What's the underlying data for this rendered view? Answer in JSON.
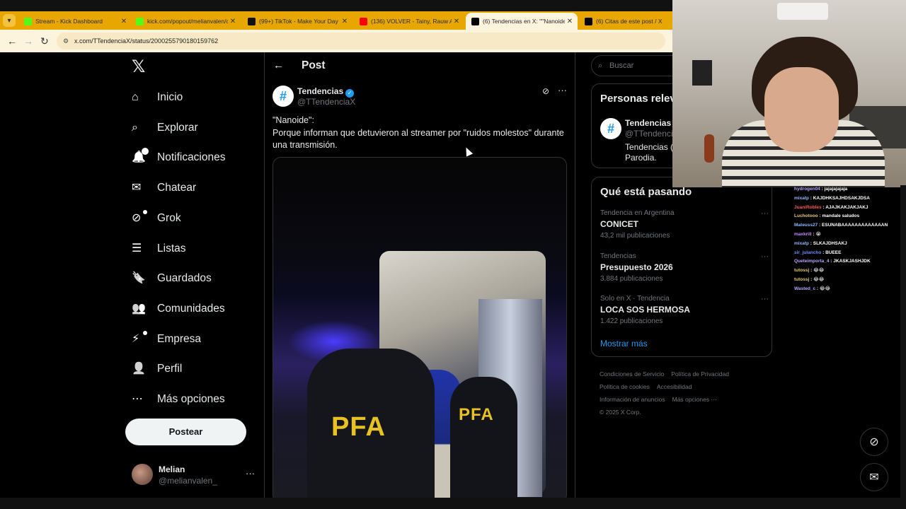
{
  "browser": {
    "tabs": [
      {
        "title": "Stream - Kick Dashboard",
        "favicon": "kick-icon",
        "color": "#53fc18"
      },
      {
        "title": "kick.com/popout/melianvalen/c",
        "favicon": "kick-icon",
        "color": "#53fc18"
      },
      {
        "title": "(99+) TikTok - Make Your Day",
        "favicon": "tiktok-icon",
        "color": "#111111"
      },
      {
        "title": "(136) VOLVER - Tainy, Rauw Ale",
        "favicon": "youtube-icon",
        "color": "#ff0000"
      },
      {
        "title": "(6) Tendencias en X: \"\"Nanoide\"",
        "favicon": "x-icon",
        "color": "#000000"
      },
      {
        "title": "(6) Citas de este post / X",
        "favicon": "x-icon",
        "color": "#000000"
      }
    ],
    "url": "x.com/TTendenciaX/status/2000255790180159762"
  },
  "nav": {
    "items": [
      {
        "label": "Inicio",
        "icon": "home-icon"
      },
      {
        "label": "Explorar",
        "icon": "search-icon"
      },
      {
        "label": "Notificaciones",
        "icon": "bell-icon",
        "badge": "6"
      },
      {
        "label": "Chatear",
        "icon": "mail-icon"
      },
      {
        "label": "Grok",
        "icon": "grok-icon"
      },
      {
        "label": "Listas",
        "icon": "list-icon"
      },
      {
        "label": "Guardados",
        "icon": "bookmark-icon"
      },
      {
        "label": "Comunidades",
        "icon": "people-icon"
      },
      {
        "label": "Empresa",
        "icon": "lightning-icon"
      },
      {
        "label": "Perfil",
        "icon": "person-icon"
      },
      {
        "label": "Más opciones",
        "icon": "more-circle-icon"
      }
    ],
    "post_button": "Postear",
    "profile": {
      "name": "Melian",
      "handle": "@melianvalen_"
    }
  },
  "post": {
    "header_title": "Post",
    "author_name": "Tendencias",
    "author_handle": "@TTendenciaX",
    "text_line1": "\"Nanoide\":",
    "text_line2": "Porque informan que detuvieron al streamer por \"ruidos molestos\" durante una transmisión.",
    "media_text": "PFA"
  },
  "right": {
    "search_placeholder": "Buscar",
    "relevant_title": "Personas relevantes",
    "relevant_person": {
      "name": "Tendencias",
      "handle": "@TTendenciaX",
      "bio": "Tendencias (cuenta)",
      "bio2": "Parodia."
    },
    "trends_title": "Qué está pasando",
    "trends": [
      {
        "context": "Tendencia en Argentina",
        "name": "CONICET",
        "count": "43,2 mil publicaciones"
      },
      {
        "context": "Tendencias",
        "name": "Presupuesto 2026",
        "count": "3.884 publicaciones"
      },
      {
        "context": "Solo en X · Tendencia",
        "name": "LOCA SOS HERMOSA",
        "count": "1.422 publicaciones"
      }
    ],
    "show_more": "Mostrar más",
    "footer": [
      "Condiciones de Servicio",
      "Política de Privacidad",
      "Política de cookies",
      "Accesibilidad",
      "Información de anuncios",
      "Más opciones ···",
      "© 2025 X Corp."
    ]
  },
  "chat": [
    {
      "user": "hydrogen04",
      "msg": "jajajajajaja",
      "color": "#b9a3ff"
    },
    {
      "user": "mixatp",
      "msg": "KAJDHKSAJHDSAKJDSA",
      "color": "#8fb7ff"
    },
    {
      "user": "JuaniRobles",
      "msg": "AJAJKAKJAKJAKJ",
      "color": "#ff5a5a"
    },
    {
      "user": "Luchotooo",
      "msg": "mandale saludos",
      "color": "#e6c97a"
    },
    {
      "user": "Mateuss27",
      "msg": "ESUNABAAAAAAAAAAAAAN",
      "color": "#8fb7ff"
    },
    {
      "user": "maxkrill",
      "msg": "😭",
      "color": "#c88bff"
    },
    {
      "user": "mixatp",
      "msg": "SLKAJDHSAKJ",
      "color": "#8fb7ff"
    },
    {
      "user": "sir_julancho",
      "msg": "BUEEE",
      "color": "#6f8dff"
    },
    {
      "user": "Queteimporta_4",
      "msg": "JKASKJASHJDK",
      "color": "#b9a3ff"
    },
    {
      "user": "tutossj",
      "msg": "😂😂",
      "color": "#e6c97a"
    },
    {
      "user": "tutossj",
      "msg": "😂😂",
      "color": "#e6c97a"
    },
    {
      "user": "Wasted_c",
      "msg": "😂😂",
      "color": "#b9a3ff"
    }
  ]
}
